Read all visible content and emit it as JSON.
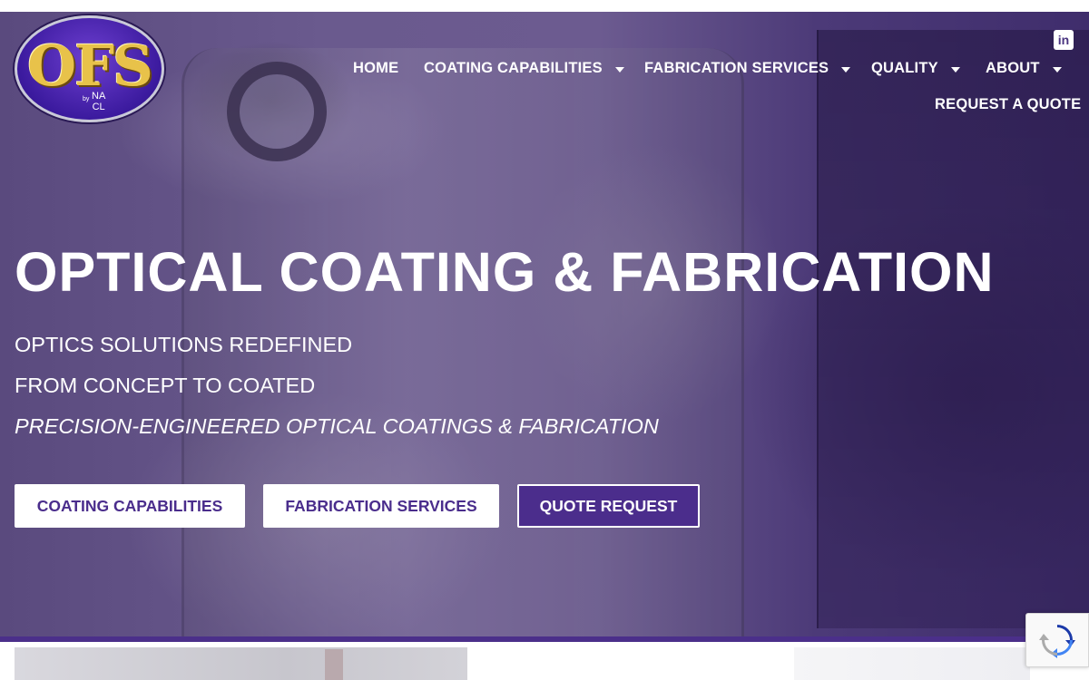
{
  "brand": {
    "logo_text": "OFS",
    "logo_by": "by",
    "logo_na": "NA",
    "logo_cl": "CL"
  },
  "nav": {
    "items": [
      {
        "label": "HOME",
        "has_dropdown": false
      },
      {
        "label": "COATING CAPABILITIES",
        "has_dropdown": true
      },
      {
        "label": "FABRICATION SERVICES",
        "has_dropdown": true
      },
      {
        "label": "QUALITY",
        "has_dropdown": true
      },
      {
        "label": "ABOUT",
        "has_dropdown": true
      }
    ],
    "request_quote": "REQUEST A QUOTE",
    "social_icon": "linkedin-icon"
  },
  "hero": {
    "title": "OPTICAL COATING & FABRICATION",
    "line1": "OPTICS SOLUTIONS REDEFINED",
    "line2": "FROM CONCEPT TO COATED",
    "line3": "PRECISION-ENGINEERED OPTICAL COATINGS & FABRICATION",
    "buttons": [
      {
        "label": "COATING CAPABILITIES"
      },
      {
        "label": "FABRICATION SERVICES"
      },
      {
        "label": "QUOTE REQUEST"
      }
    ]
  },
  "colors": {
    "brand_purple": "#4b2d8c",
    "text_light": "#ffffff",
    "logo_gold": "#e8c24a"
  }
}
